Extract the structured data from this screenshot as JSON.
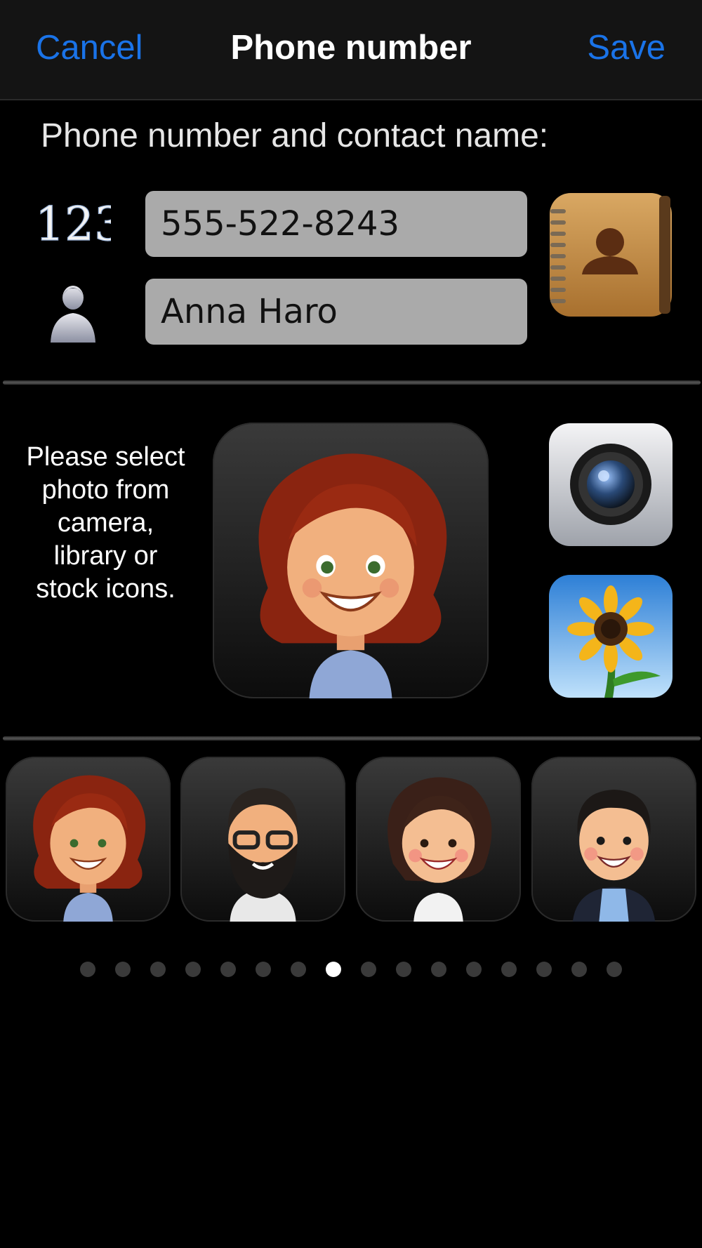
{
  "nav": {
    "cancel_label": "Cancel",
    "title": "Phone number",
    "save_label": "Save",
    "accent_color": "#1a73e8"
  },
  "form": {
    "section_label": "Phone number and contact name:",
    "digits_icon_text": "123",
    "phone_value": "555-522-8243",
    "name_value": "Anna Haro"
  },
  "photo": {
    "hint_lines": [
      "Please select",
      "photo from",
      "camera,",
      "library or",
      "stock icons."
    ],
    "preview_icon": "avatar-redhead-woman",
    "camera_icon": "camera-icon",
    "photos_icon": "sunflower-photos-icon",
    "contacts_icon": "address-book-icon"
  },
  "stock_icons": [
    {
      "name": "avatar-redhead-woman"
    },
    {
      "name": "avatar-bearded-man-glasses"
    },
    {
      "name": "avatar-dark-hair-woman"
    },
    {
      "name": "avatar-young-man"
    }
  ],
  "pagination": {
    "total": 16,
    "current": 8
  }
}
